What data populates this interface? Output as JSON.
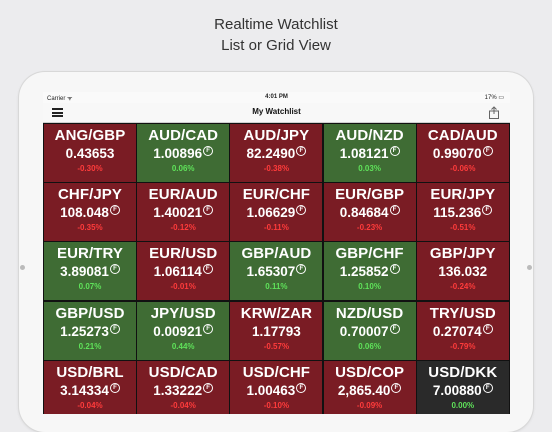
{
  "promo": {
    "line1": "Realtime Watchlist",
    "line2": "List or Grid View"
  },
  "status": {
    "carrier": "Carrier ᯤ",
    "time": "4:01 PM",
    "battery": "17% ▭"
  },
  "navbar": {
    "title": "My Watchlist"
  },
  "badge": "F",
  "colors": {
    "red": "#7a1c24",
    "green": "#3f6c34",
    "dark": "#2a2a2a",
    "pos": "#5fe25a",
    "neg": "#ff3b3b"
  },
  "tiles": [
    {
      "pair": "ANG/GBP",
      "price": "0.43653",
      "change": "-0.30%",
      "color": "red",
      "badge": false
    },
    {
      "pair": "AUD/CAD",
      "price": "1.00896",
      "change": "0.06%",
      "color": "green",
      "badge": true
    },
    {
      "pair": "AUD/JPY",
      "price": "82.2490",
      "change": "-0.38%",
      "color": "red",
      "badge": true
    },
    {
      "pair": "AUD/NZD",
      "price": "1.08121",
      "change": "0.03%",
      "color": "green",
      "badge": true
    },
    {
      "pair": "CAD/AUD",
      "price": "0.99070",
      "change": "-0.06%",
      "color": "red",
      "badge": true
    },
    {
      "pair": "CHF/JPY",
      "price": "108.048",
      "change": "-0.35%",
      "color": "red",
      "badge": true
    },
    {
      "pair": "EUR/AUD",
      "price": "1.40021",
      "change": "-0.12%",
      "color": "red",
      "badge": true
    },
    {
      "pair": "EUR/CHF",
      "price": "1.06629",
      "change": "-0.11%",
      "color": "red",
      "badge": true
    },
    {
      "pair": "EUR/GBP",
      "price": "0.84684",
      "change": "-0.23%",
      "color": "red",
      "badge": true
    },
    {
      "pair": "EUR/JPY",
      "price": "115.236",
      "change": "-0.51%",
      "color": "red",
      "badge": true
    },
    {
      "pair": "EUR/TRY",
      "price": "3.89081",
      "change": "0.07%",
      "color": "green",
      "badge": true
    },
    {
      "pair": "EUR/USD",
      "price": "1.06114",
      "change": "-0.01%",
      "color": "red",
      "badge": true
    },
    {
      "pair": "GBP/AUD",
      "price": "1.65307",
      "change": "0.11%",
      "color": "green",
      "badge": true
    },
    {
      "pair": "GBP/CHF",
      "price": "1.25852",
      "change": "0.10%",
      "color": "green",
      "badge": true
    },
    {
      "pair": "GBP/JPY",
      "price": "136.032",
      "change": "-0.24%",
      "color": "red",
      "badge": false
    },
    {
      "pair": "GBP/USD",
      "price": "1.25273",
      "change": "0.21%",
      "color": "green",
      "badge": true
    },
    {
      "pair": "JPY/USD",
      "price": "0.00921",
      "change": "0.44%",
      "color": "green",
      "badge": true
    },
    {
      "pair": "KRW/ZAR",
      "price": "1.17793",
      "change": "-0.57%",
      "color": "red",
      "badge": false
    },
    {
      "pair": "NZD/USD",
      "price": "0.70007",
      "change": "0.06%",
      "color": "green",
      "badge": true
    },
    {
      "pair": "TRY/USD",
      "price": "0.27074",
      "change": "-0.79%",
      "color": "red",
      "badge": true
    },
    {
      "pair": "USD/BRL",
      "price": "3.14334",
      "change": "-0.04%",
      "color": "red",
      "badge": true
    },
    {
      "pair": "USD/CAD",
      "price": "1.33222",
      "change": "-0.04%",
      "color": "red",
      "badge": true
    },
    {
      "pair": "USD/CHF",
      "price": "1.00463",
      "change": "-0.10%",
      "color": "red",
      "badge": true
    },
    {
      "pair": "USD/COP",
      "price": "2,865.40",
      "change": "-0.09%",
      "color": "red",
      "badge": true
    },
    {
      "pair": "USD/DKK",
      "price": "7.00880",
      "change": "0.00%",
      "color": "dark",
      "badge": true
    }
  ]
}
